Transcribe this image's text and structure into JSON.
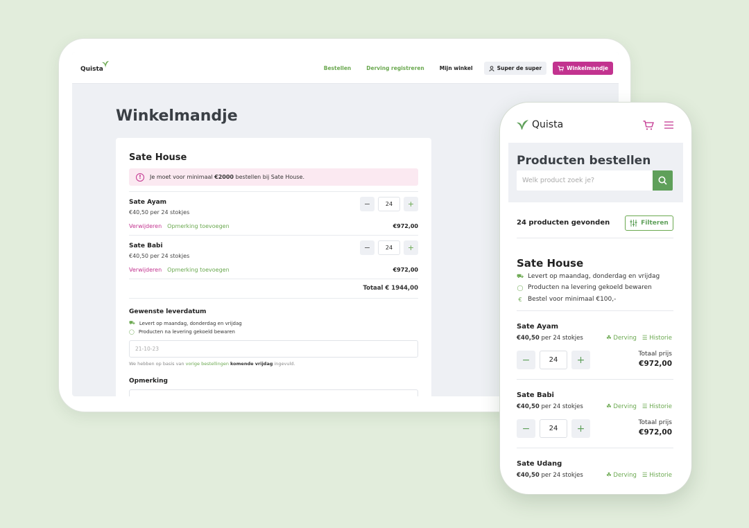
{
  "tablet": {
    "brand": "Quista",
    "brand_sub": "",
    "nav": {
      "order": "Bestellen",
      "waste": "Derving registreren",
      "my_store": "Mijn winkel",
      "user": "Super de super",
      "cart": "Winkelmandje"
    },
    "page_title": "Winkelmandje",
    "shop_name": "Sate House",
    "alert": {
      "prefix": "Je moet voor minimaal ",
      "amount": "€2000",
      "suffix": " bestellen bij Sate House."
    },
    "items": [
      {
        "name": "Sate Ayam",
        "price": "€40,50 per 24 stokjes",
        "qty": "24",
        "total": "€972,00",
        "remove": "Verwijderen",
        "note": "Opmerking toevoegen"
      },
      {
        "name": "Sate Babi",
        "price": "€40,50 per 24 stokjes",
        "qty": "24",
        "total": "€972,00",
        "remove": "Verwijderen",
        "note": "Opmerking toevoegen"
      }
    ],
    "grand_total": "Totaal € 1944,00",
    "delivery": {
      "heading": "Gewenste leverdatum",
      "info1": "Levert op maandag, donderdag en vrijdag",
      "info2": "Producten na levering gekoeld bewaren",
      "date_value": "21-10-23",
      "hint_pre": "We hebben op basis van ",
      "hint_link": "vorige bestellingen",
      "hint_mid": " ",
      "hint_bold": "komende vrijdag",
      "hint_post": " ingevuld."
    },
    "remark_heading": "Opmerking"
  },
  "phone": {
    "brand": "Quista",
    "title": "Producten bestellen",
    "search_placeholder": "Welk product zoek je?",
    "found": "24 producten gevonden",
    "filter": "Filteren",
    "shop": {
      "name": "Sate House",
      "info1": "Levert op maandag, donderdag en vrijdag",
      "info2": "Producten na levering gekoeld bewaren",
      "info3": "Bestel voor minimaal €100,-"
    },
    "products": [
      {
        "name": "Sate Ayam",
        "price_bold": "€40,50",
        "price_rest": " per 24 stokjes",
        "waste": "Derving",
        "history": "Historie",
        "qty": "24",
        "total_label": "Totaal prijs",
        "total": "€972,00"
      },
      {
        "name": "Sate Babi",
        "price_bold": "€40,50",
        "price_rest": " per 24 stokjes",
        "waste": "Derving",
        "history": "Historie",
        "qty": "24",
        "total_label": "Totaal prijs",
        "total": "€972,00"
      },
      {
        "name": "Sate Udang",
        "price_bold": "€40,50",
        "price_rest": " per 24 stokjes",
        "waste": "Derving",
        "history": "Historie"
      }
    ]
  },
  "colors": {
    "accent_green": "#5fa05a",
    "accent_magenta": "#c2338f",
    "background": "#e2eddc"
  }
}
